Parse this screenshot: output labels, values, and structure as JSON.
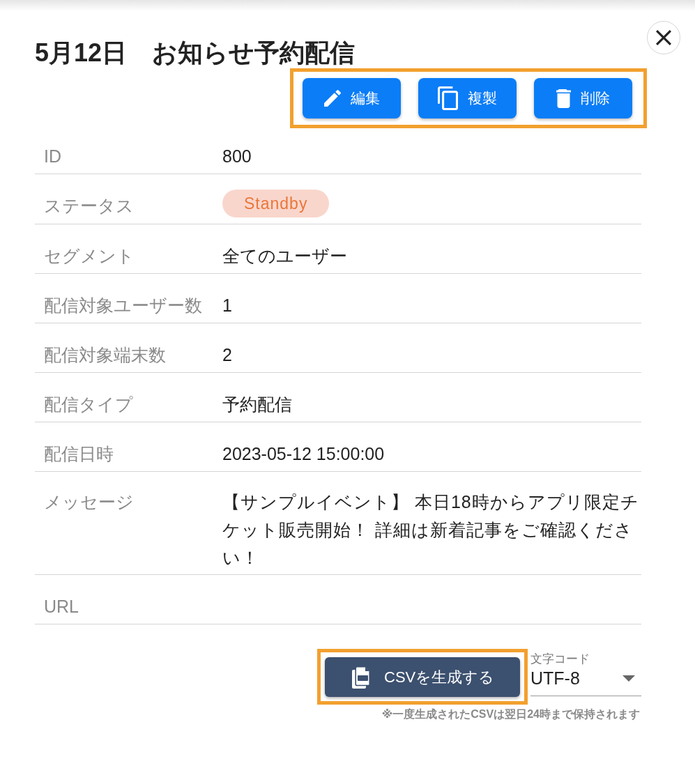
{
  "dialog": {
    "title": "5月12日　お知らせ予約配信"
  },
  "actions": {
    "highlighted": true,
    "buttons": [
      {
        "kind": "edit",
        "label": "編集"
      },
      {
        "kind": "duplicate",
        "label": "複製"
      },
      {
        "kind": "delete",
        "label": "削除"
      }
    ]
  },
  "details": [
    {
      "kind": "text",
      "label": "ID",
      "value": "800"
    },
    {
      "kind": "badge",
      "label": "ステータス",
      "value": "Standby"
    },
    {
      "kind": "text",
      "label": "セグメント",
      "value": "全てのユーザー"
    },
    {
      "kind": "text",
      "label": "配信対象ユーザー数",
      "value": "1"
    },
    {
      "kind": "text",
      "label": "配信対象端末数",
      "value": "2"
    },
    {
      "kind": "text",
      "label": "配信タイプ",
      "value": "予約配信"
    },
    {
      "kind": "text",
      "label": "配信日時",
      "value": "2023-05-12 15:00:00"
    },
    {
      "kind": "multiline",
      "label": "メッセージ",
      "value": "【サンプルイベント】 本日18時からアプリ限定チケット販売開始！ 詳細は新着記事をご確認ください！"
    },
    {
      "kind": "text",
      "label": "URL"
    }
  ],
  "export": {
    "highlighted": true,
    "button": "CSVを生成する",
    "encoding": {
      "label": "文字コード",
      "value": "UTF-8"
    },
    "note": "※一度生成されたCSVは翌日24時まで保持されます"
  }
}
